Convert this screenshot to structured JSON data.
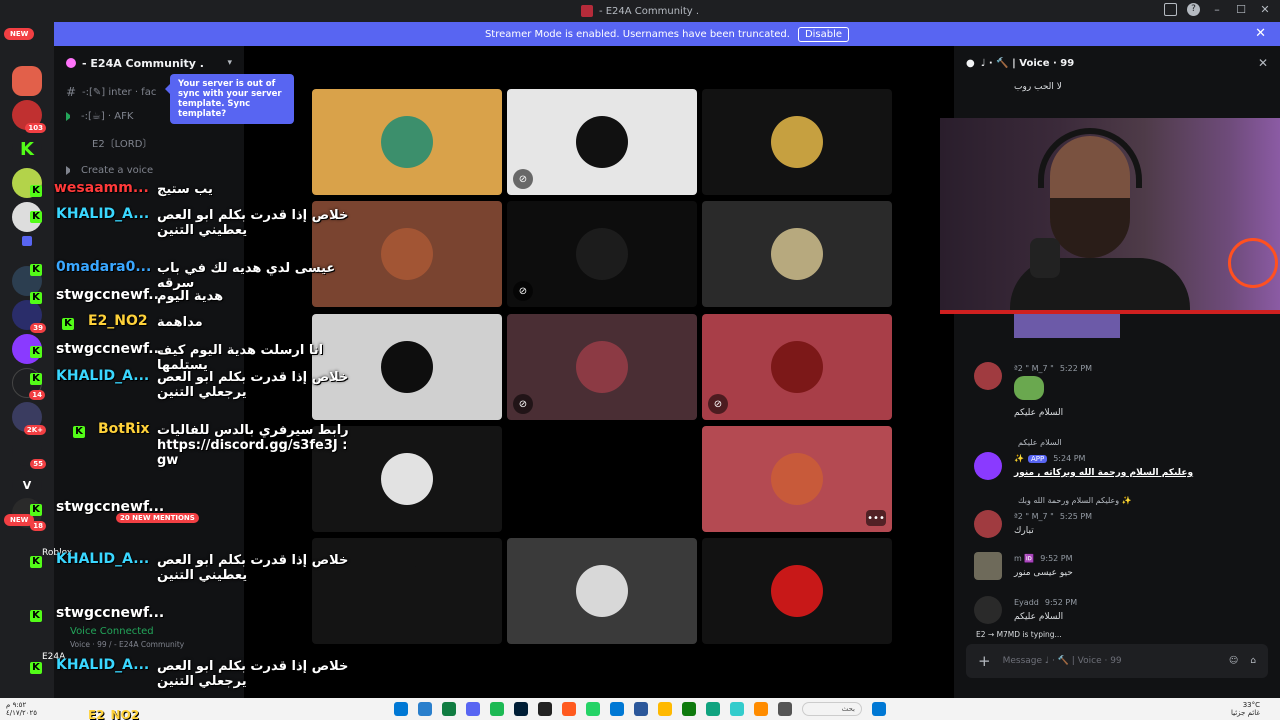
{
  "titlebar": {
    "title": "- E24A Community ."
  },
  "banner": {
    "text": "Streamer Mode is enabled. Usernames have been truncated.",
    "disable_label": "Disable"
  },
  "rail": {
    "new_top": "NEW",
    "new_bottom": "NEW",
    "badges": [
      "103",
      "39",
      "14",
      "2K+",
      "55",
      "18"
    ],
    "letters": [
      "V"
    ]
  },
  "sidebar": {
    "server_name": "- E24A Community .",
    "tooltip": "Your server is out of sync with your server template. Sync template?",
    "channels": [
      {
        "name": "-:[✎] inter · fac",
        "type": "text"
      },
      {
        "name": "-:[☕] · AFK",
        "type": "voice"
      },
      {
        "name": "E2〔LORD〕",
        "type": "member"
      },
      {
        "name": "Create a voice",
        "type": "voice"
      }
    ],
    "voice_connected": "Voice Connected",
    "voice_sub": "Voice · 99 / - E24A Community"
  },
  "overlay": {
    "messages": [
      {
        "user": "wesaamm...",
        "user_color": "#ff3a3a",
        "text": "يب ستيج"
      },
      {
        "user": "KHALID_A...",
        "user_color": "#3ad7ff",
        "text": "خلاص إذا قدرت بكلم ابو العص يعطيني التنين"
      },
      {
        "user": "0madara0...",
        "user_color": "#3aa7ff",
        "text": "عيسى لدي هديه لك في باب سرقه"
      },
      {
        "user": "stwgccnewf...",
        "user_color": "#ffffff",
        "text": "هدية اليوم"
      },
      {
        "user": "E2_NO2",
        "user_color": "#ffd23a",
        "text": "مداهمة"
      },
      {
        "user": "stwgccnewf...",
        "user_color": "#ffffff",
        "text": "انا ارسلت هدية اليوم كيف يستلمها"
      },
      {
        "user": "KHALID_A...",
        "user_color": "#3ad7ff",
        "text": "خلاص إذا قدرت بكلم ابو العص يرجعلي التنين"
      },
      {
        "user": "BotRix",
        "user_color": "#ffd23a",
        "text": "رابط سيرفري بالدس للفاليات : https://discord.gg/s3fe3J gw"
      },
      {
        "user": "stwgccnewf...",
        "user_color": "#ffffff",
        "text": ""
      },
      {
        "user": "KHALID_A...",
        "user_color": "#3ad7ff",
        "text": "خلاص إذا قدرت بكلم ابو العص يعطيني التنين"
      },
      {
        "user": "stwgccnewf...",
        "user_color": "#ffffff",
        "text": ""
      },
      {
        "user": "KHALID_A...",
        "user_color": "#3ad7ff",
        "text": "خلاص إذا قدرت بكلم ابو العص يرجعلي التنين"
      }
    ],
    "new_mentions": "20 NEW MENTIONS",
    "roblox": "Roblox",
    "e24a": "E24A",
    "e2no2": "E2_NO2"
  },
  "stage": {
    "tiles": [
      {
        "bg": "#d9a24a",
        "avatar": "#3c8f6c",
        "muted": false
      },
      {
        "bg": "#e6e6e6",
        "avatar": "#111111",
        "muted": true
      },
      {
        "bg": "#121212",
        "avatar": "#c6a040",
        "muted": false
      },
      {
        "bg": "#7a4430",
        "avatar": "#a25534",
        "muted": false
      },
      {
        "bg": "#0d0d0d",
        "avatar": "#1c1c1c",
        "muted": true
      },
      {
        "bg": "#2a2a2a",
        "avatar": "#b7a97e",
        "muted": false
      },
      {
        "bg": "#d0d0d0",
        "avatar": "#0e0e0e",
        "muted": false
      },
      {
        "bg": "#4a2e34",
        "avatar": "#8c3a44",
        "muted": true
      },
      {
        "bg": "#a83e48",
        "avatar": "#7c1818",
        "muted": true
      },
      {
        "bg": "#141414",
        "avatar": "#e2e2e2",
        "muted": false
      },
      {
        "bg": "#000000",
        "avatar": "#000000",
        "muted": false
      },
      {
        "bg": "#b44a52",
        "avatar": "#c85a3a",
        "muted": false
      },
      {
        "bg": "#141414",
        "avatar": "#141414",
        "muted": false
      },
      {
        "bg": "#3a3a3a",
        "avatar": "#d8d8d8",
        "muted": false
      },
      {
        "bg": "#121212",
        "avatar": "#c81818",
        "muted": false
      }
    ]
  },
  "panel": {
    "header": "♩ · 🔨 | Voice · 99",
    "top_text": "لا الحب روب",
    "messages": [
      {
        "name": "ª2 \" M_7 \"",
        "time": "5:22 PM",
        "text": "السلام عليكم",
        "color": "#a03b40"
      },
      {
        "name": "✨",
        "time": "5:24 PM",
        "text": "وعليكم السلام ورحمة الله وبركاته , منور",
        "color": "#8a3aff",
        "app": "APP",
        "reply": "السلام عليكم"
      },
      {
        "name": "ª2 \" M_7 \"",
        "time": "5:25 PM",
        "text": "تبارك",
        "color": "#a03b40",
        "reply": "وعليكم السلام ورحمة الله وبك ✨",
        "app": "APP"
      },
      {
        "name": "m 🆔",
        "time": "9:52 PM",
        "text": "حيو عيسى منور",
        "color": "#6e6a5a"
      },
      {
        "name": "Eyadd",
        "time": "9:52 PM",
        "text": "السلام عليكم",
        "color": "#2a2a2a"
      }
    ],
    "typing": "E2 → M7MD is typing...",
    "input_placeholder": "Message ♩ · 🔨 | Voice · 99"
  },
  "taskbar": {
    "time": "٩:٥٢ م",
    "date": "٤/١٧/٢٠٢٥",
    "search": "بحث",
    "weather": "33°C",
    "weather_sub": "غائم جزئيا",
    "icons": [
      "#0078d4",
      "#2a7fcc",
      "#107c41",
      "#5865f2",
      "#1db954",
      "#001e36",
      "#222",
      "#ff5a1f",
      "#25d366",
      "#0078d4",
      "#2b579a",
      "#ffb900",
      "#0e7a0d",
      "#10a37f",
      "#3cc",
      "#ff8c00",
      "#555"
    ]
  }
}
